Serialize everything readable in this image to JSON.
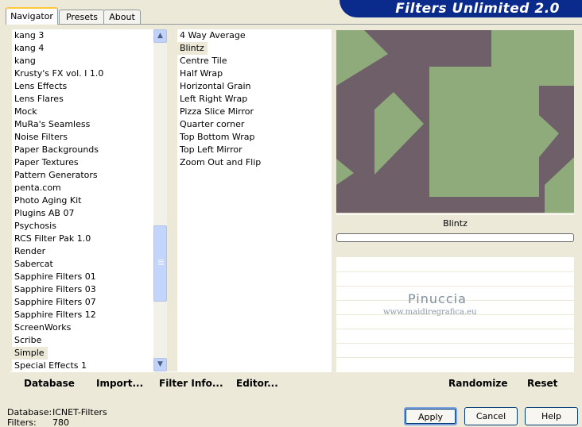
{
  "app": {
    "title": "Filters Unlimited 2.0"
  },
  "tabs": [
    {
      "label": "Navigator",
      "active": true
    },
    {
      "label": "Presets",
      "active": false
    },
    {
      "label": "About",
      "active": false
    }
  ],
  "categories": {
    "items": [
      "kang 3",
      "kang 4",
      "kang",
      "Krusty's FX vol. I 1.0",
      "Lens Effects",
      "Lens Flares",
      "Mock",
      "MuRa's Seamless",
      "Noise Filters",
      "Paper Backgrounds",
      "Paper Textures",
      "Pattern Generators",
      "penta.com",
      "Photo Aging Kit",
      "Plugins AB 07",
      "Psychosis",
      "RCS Filter Pak 1.0",
      "Render",
      "Sabercat",
      "Sapphire Filters 01",
      "Sapphire Filters 03",
      "Sapphire Filters 07",
      "Sapphire Filters 12",
      "ScreenWorks",
      "Scribe",
      "Simple",
      "Special Effects 1"
    ],
    "selected": "Simple",
    "scroll_position": 0.62
  },
  "filters": {
    "items": [
      "4 Way Average",
      "Blintz",
      "Centre Tile",
      "Half Wrap",
      "Horizontal Grain",
      "Left Right Wrap",
      "Pizza Slice Mirror",
      "Quarter corner",
      "Top Bottom Wrap",
      "Top Left Mirror",
      "Zoom Out and Flip"
    ],
    "selected": "Blintz"
  },
  "left_buttons": {
    "database": "Database",
    "import": "Import...",
    "filter_info": "Filter Info...",
    "editor": "Editor..."
  },
  "preview": {
    "filter_name": "Blintz",
    "progress": 0,
    "colors": {
      "background": "#6f5f68",
      "shapes": "#8fab7b"
    }
  },
  "right_buttons": {
    "randomize": "Randomize",
    "reset": "Reset"
  },
  "watermark": {
    "line1": "Pinuccia",
    "line2": "www.maidiregrafica.eu"
  },
  "footer": {
    "database_label": "Database:",
    "database_value": "ICNET-Filters",
    "filters_label": "Filters:",
    "filters_value": "780",
    "apply": "Apply",
    "cancel": "Cancel",
    "help": "Help"
  }
}
